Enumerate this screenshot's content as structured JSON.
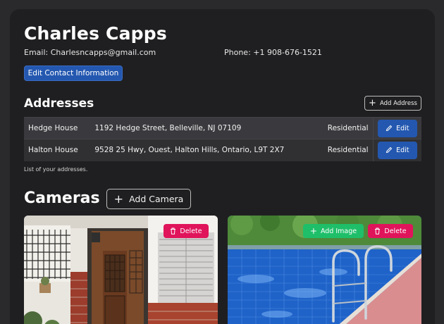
{
  "profile": {
    "name": "Charles Capps",
    "email": "Email: Charlesncapps@gmail.com",
    "phone": "Phone: +1 908-676-1521",
    "edit_contact_label": "Edit Contact Information"
  },
  "addresses": {
    "title": "Addresses",
    "add_label": "Add Address",
    "caption": "List of your addresses.",
    "rows": [
      {
        "name": "Hedge House",
        "address": "1192 Hedge Street, Belleville, NJ 07109",
        "type": "Residential",
        "edit_label": "Edit"
      },
      {
        "name": "Halton House",
        "address": "9528 25 Hwy, Ouest, Halton Hills, Ontario, L9T 2X7",
        "type": "Residential",
        "edit_label": "Edit"
      }
    ]
  },
  "cameras": {
    "title": "Cameras",
    "add_label": "Add Camera",
    "cards": [
      {
        "delete_label": "Delete"
      },
      {
        "add_image_label": "Add Image",
        "delete_label": "Delete"
      }
    ]
  },
  "colors": {
    "primary": "#2458b0",
    "danger": "#e0145b",
    "success": "#1fbf6a",
    "panel": "#1f1f21",
    "background": "#2a2a2c"
  },
  "icons": [
    "plus-icon",
    "pencil-icon",
    "trash-icon"
  ]
}
